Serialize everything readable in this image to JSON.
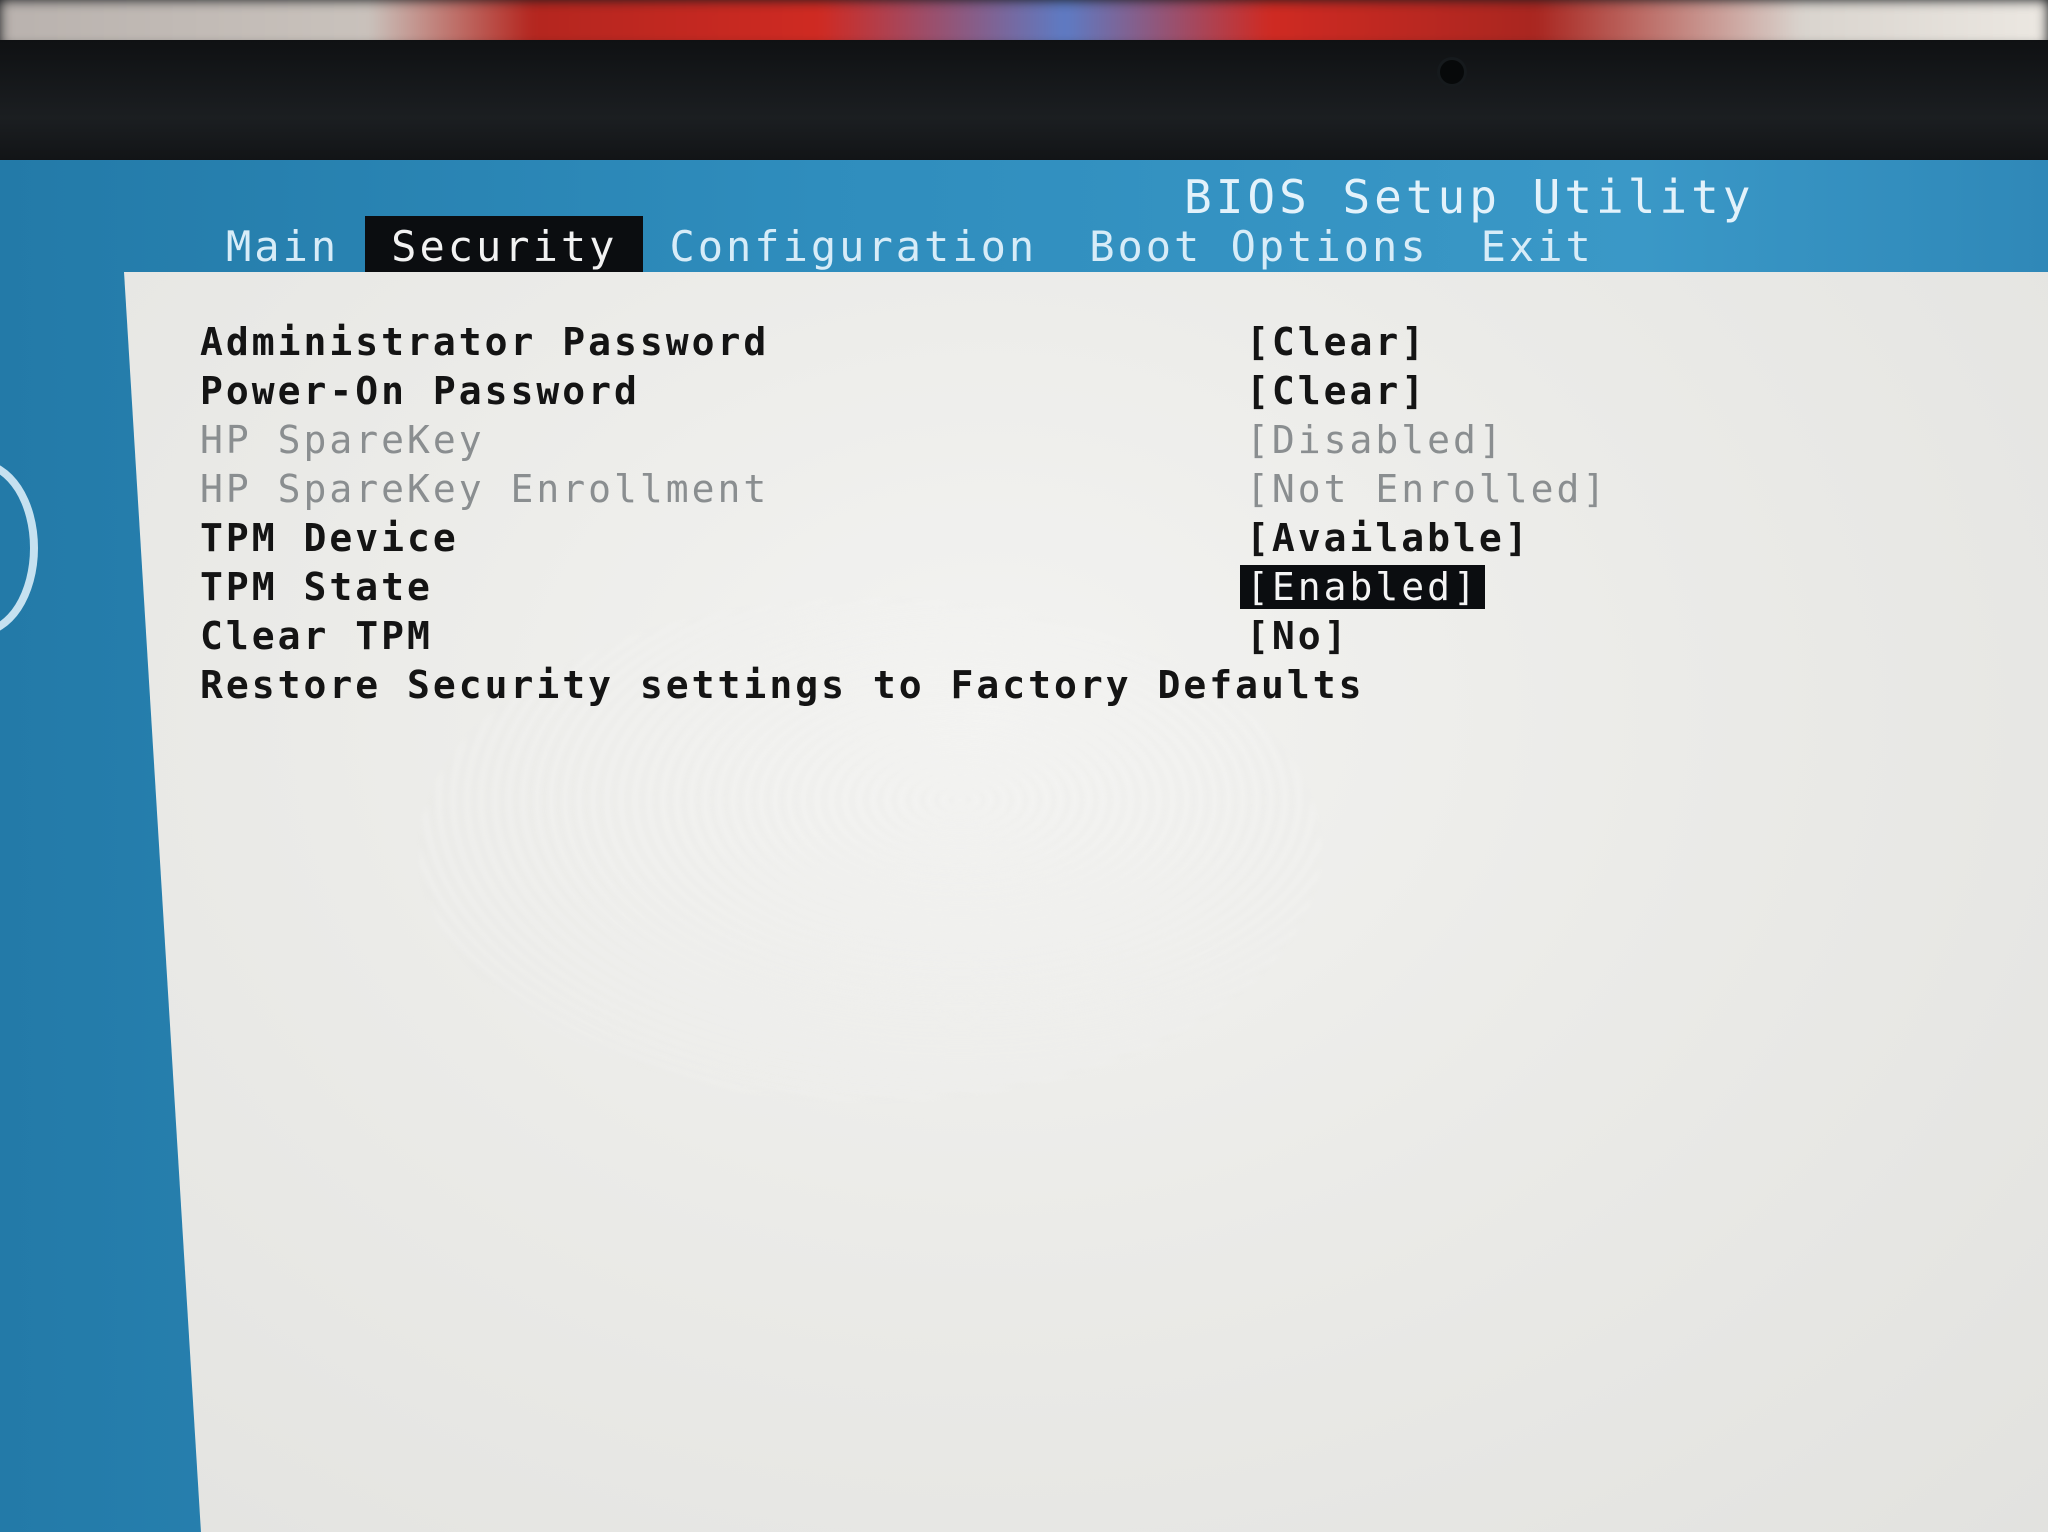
{
  "bios": {
    "title": "BIOS Setup Utility",
    "tabs": [
      {
        "label": "Main"
      },
      {
        "label": "Security",
        "active": true
      },
      {
        "label": "Configuration"
      },
      {
        "label": "Boot Options"
      },
      {
        "label": "Exit"
      }
    ],
    "settings": [
      {
        "label": "Administrator Password",
        "value": "[Clear]"
      },
      {
        "label": "Power-On Password",
        "value": "[Clear]"
      },
      {
        "label": "HP SpareKey",
        "value": "[Disabled]",
        "disabled": true
      },
      {
        "label": "HP SpareKey Enrollment",
        "value": "[Not Enrolled]",
        "disabled": true
      },
      {
        "label": "TPM Device",
        "value": "[Available]"
      },
      {
        "label": "TPM State",
        "value": "[Enabled]",
        "selected": true
      },
      {
        "label": "Clear TPM",
        "value": "[No]"
      },
      {
        "label": "Restore Security settings to Factory Defaults"
      }
    ]
  },
  "colors": {
    "header_blue": "#3a98c7",
    "panel_background": "#ebebe8",
    "selection_background": "#0b0d10",
    "disabled_text": "#8a8e90"
  }
}
